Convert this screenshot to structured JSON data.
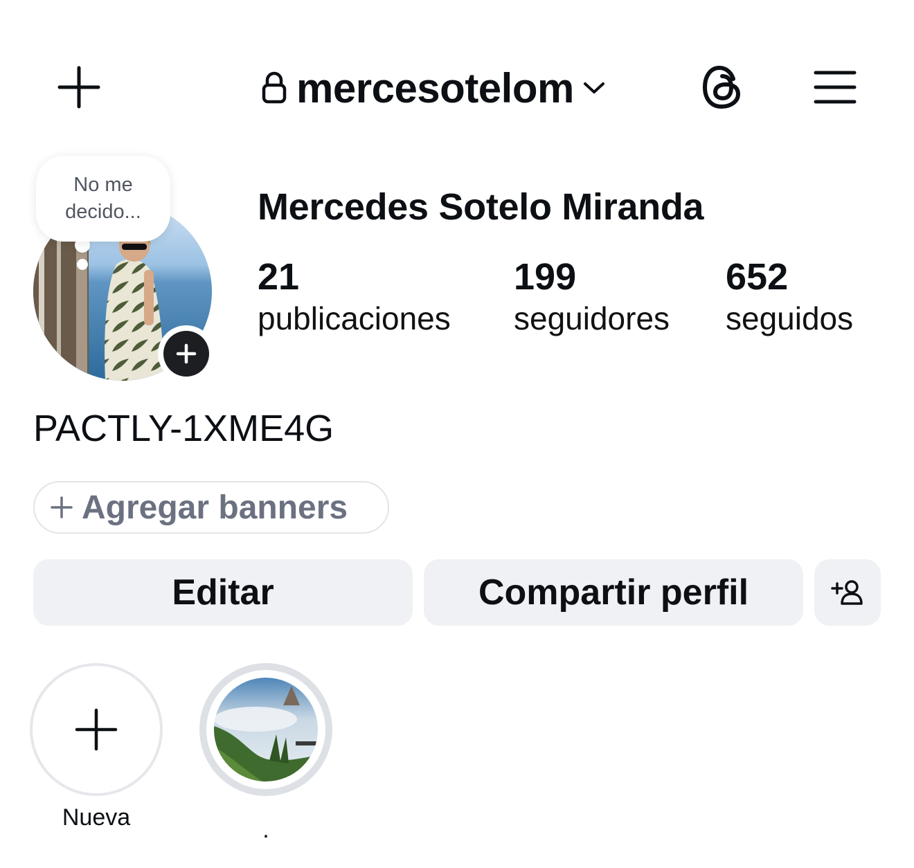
{
  "header": {
    "username": "mercesotelom",
    "icons": [
      "plus-icon",
      "lock-icon",
      "chevron-down-icon",
      "threads-icon",
      "hamburger-menu-icon"
    ]
  },
  "note": {
    "text": "No me decido..."
  },
  "profile": {
    "full_name": "Mercedes Sotelo Miranda",
    "stats": {
      "posts": {
        "value": "21",
        "label": "publicaciones"
      },
      "followers": {
        "value": "199",
        "label": "seguidores"
      },
      "following": {
        "value": "652",
        "label": "seguidos"
      }
    },
    "bio": "PACTLY-1XME4G"
  },
  "banners": {
    "label": "Agregar banners"
  },
  "actions": {
    "edit_label": "Editar",
    "share_label": "Compartir perfil"
  },
  "highlights": [
    {
      "label": "Nueva"
    },
    {
      "label": "."
    }
  ],
  "colors": {
    "text": "#0c0f14",
    "button_bg": "#f0f1f4",
    "muted": "#6b7180",
    "ring": "#dde0e5"
  }
}
